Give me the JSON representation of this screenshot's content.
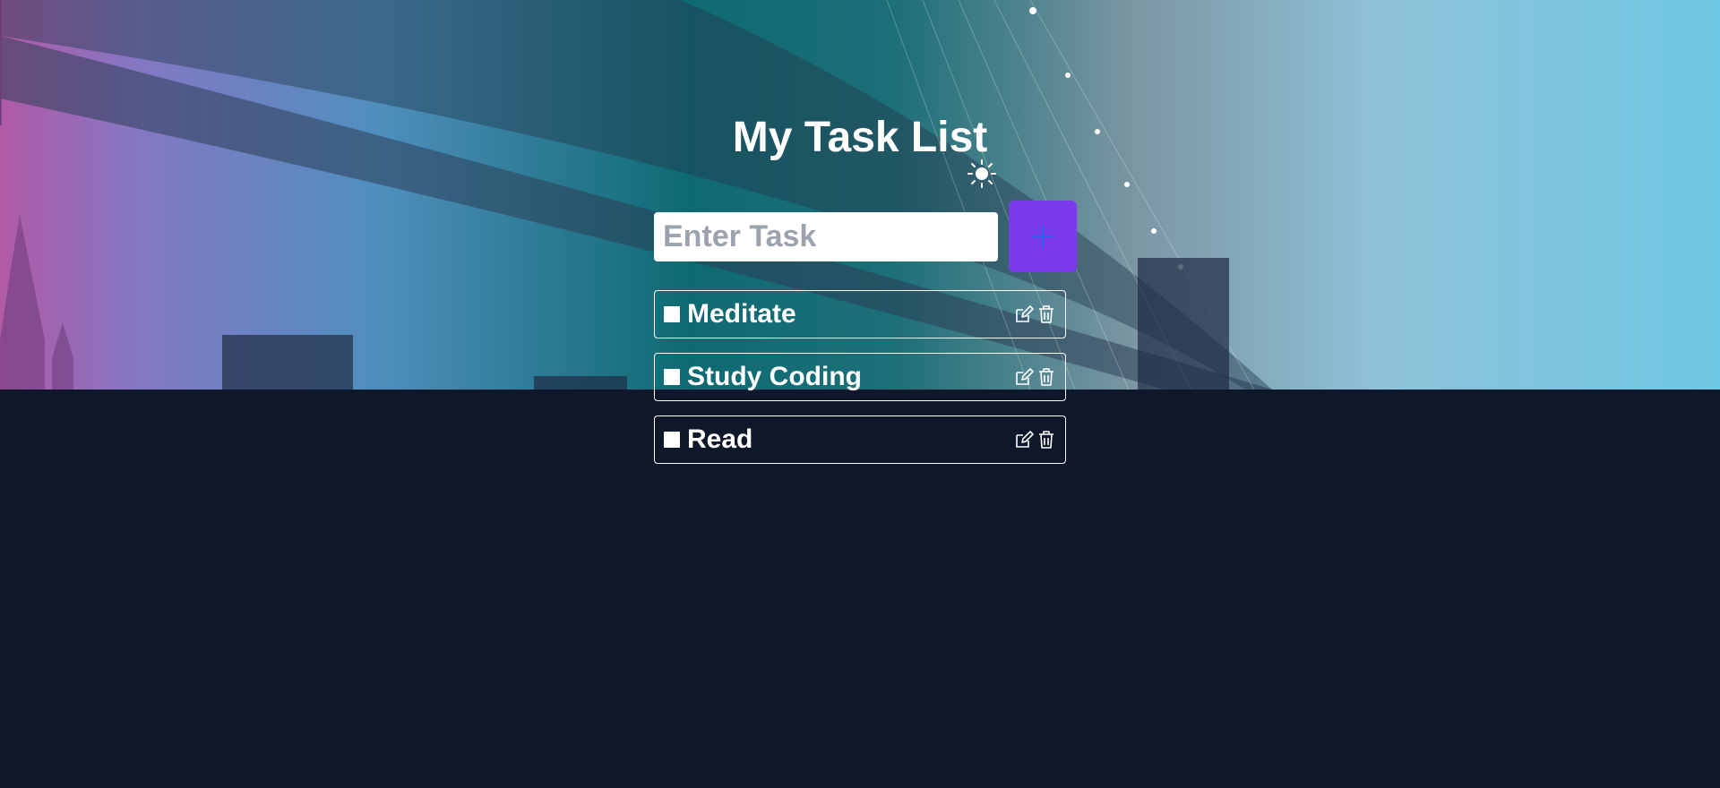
{
  "header": {
    "title": "My Task List",
    "theme_toggle_icon": "sun-icon"
  },
  "form": {
    "input_value": "",
    "input_placeholder": "Enter Task",
    "add_button_icon": "plus-icon"
  },
  "tasks": [
    {
      "label": "Meditate",
      "completed": false
    },
    {
      "label": "Study Coding",
      "completed": false
    },
    {
      "label": "Read",
      "completed": false
    }
  ],
  "task_actions": {
    "edit_icon": "edit-icon",
    "delete_icon": "trash-icon"
  },
  "colors": {
    "page_background": "#0f172a",
    "accent": "#7c3aed",
    "add_icon": "#2563eb",
    "text": "#ffffff"
  }
}
